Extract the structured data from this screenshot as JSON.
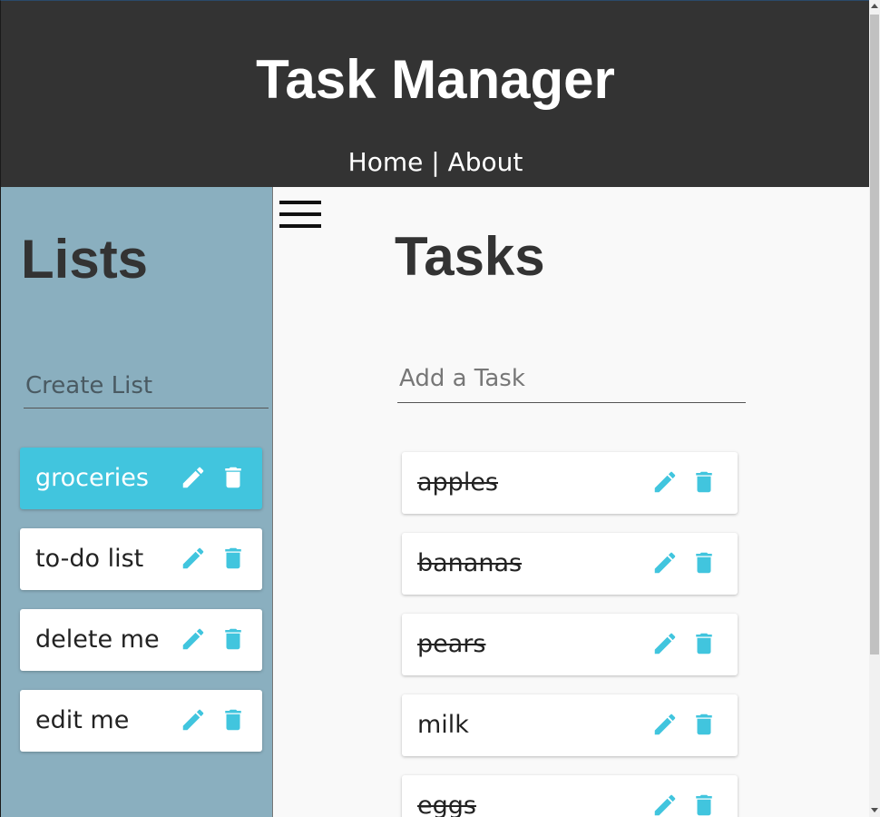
{
  "header": {
    "title": "Task Manager",
    "nav": {
      "home": "Home",
      "separator": " | ",
      "about": "About"
    }
  },
  "sidebar": {
    "heading": "Lists",
    "create_placeholder": "Create List",
    "lists": [
      {
        "label": "groceries",
        "active": true
      },
      {
        "label": "to-do list",
        "active": false
      },
      {
        "label": "delete me",
        "active": false
      },
      {
        "label": "edit me",
        "active": false
      }
    ]
  },
  "main": {
    "menu_icon": "hamburger-menu-icon",
    "heading": "Tasks",
    "add_placeholder": "Add a Task",
    "tasks": [
      {
        "label": "apples",
        "completed": true
      },
      {
        "label": "bananas",
        "completed": true
      },
      {
        "label": "pears",
        "completed": true
      },
      {
        "label": "milk",
        "completed": false
      },
      {
        "label": "eggs",
        "completed": true
      }
    ]
  },
  "icons": {
    "edit": "pencil-icon",
    "delete": "trash-icon"
  },
  "colors": {
    "header_bg": "#333333",
    "sidebar_bg": "#8aafbf",
    "accent": "#41c5de",
    "main_bg": "#f9f9f9"
  }
}
